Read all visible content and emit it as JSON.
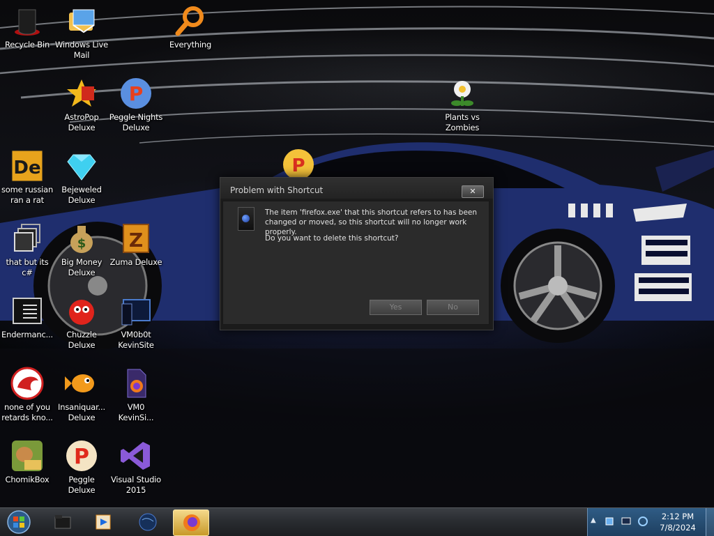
{
  "desktop_icons": [
    {
      "label": "Recycle Bin",
      "icon": "recycle-bin-icon"
    },
    {
      "label": "Windows Live\nMail",
      "icon": "mail-icon"
    },
    {
      "label": "Everything",
      "icon": "search-magnifier-icon"
    },
    {
      "label": "AstroPop\nDeluxe",
      "icon": "astropop-icon"
    },
    {
      "label": "Peggle Nights\nDeluxe",
      "icon": "peggle-icon"
    },
    {
      "label": "Plants vs\nZombies",
      "icon": "plant-icon"
    },
    {
      "label": "some russian\nran a rat",
      "icon": "de-app-icon"
    },
    {
      "label": "Bejeweled\nDeluxe",
      "icon": "gem-icon"
    },
    {
      "label": "that but its c#",
      "icon": "stacked-windows-icon"
    },
    {
      "label": "Big Money\nDeluxe",
      "icon": "money-bag-icon"
    },
    {
      "label": "Zuma Deluxe",
      "icon": "zuma-icon"
    },
    {
      "label": "Endermanc...",
      "icon": "console-icon"
    },
    {
      "label": "Chuzzle\nDeluxe",
      "icon": "chuzzle-icon"
    },
    {
      "label": "VM0b0t\nKevinSite",
      "icon": "terminal-icon"
    },
    {
      "label": "none of you\nretards kno...",
      "icon": "dragon-icon"
    },
    {
      "label": "Insaniquar...\nDeluxe",
      "icon": "fish-icon"
    },
    {
      "label": "VM0\nKevinSi...",
      "icon": "firefox-file-icon"
    },
    {
      "label": "ChomikBox",
      "icon": "hamster-box-icon"
    },
    {
      "label": "Peggle Deluxe",
      "icon": "peggle-icon"
    },
    {
      "label": "Visual Studio\n2015",
      "icon": "visual-studio-icon"
    }
  ],
  "dialog": {
    "title": "Problem with Shortcut",
    "close_label": "✕",
    "message": "The item 'firefox.exe' that this shortcut refers to has been changed or moved, so this shortcut will no longer work properly.",
    "question": "Do you want to delete this shortcut?",
    "yes_label": "Yes",
    "no_label": "No"
  },
  "taskbar": {
    "items": [
      {
        "icon": "start-orb-icon"
      },
      {
        "icon": "folder-icon"
      },
      {
        "icon": "media-player-icon"
      },
      {
        "icon": "globe-icon"
      },
      {
        "icon": "firefox-icon",
        "active": true
      }
    ],
    "tray": {
      "chevron": "▲",
      "time": "2:12 PM",
      "date": "7/8/2024"
    }
  },
  "colors": {
    "dialog_bg": "#2b2b2b",
    "taskbar_tray": "#2f5c85",
    "car_blue": "#1f2e6e"
  }
}
